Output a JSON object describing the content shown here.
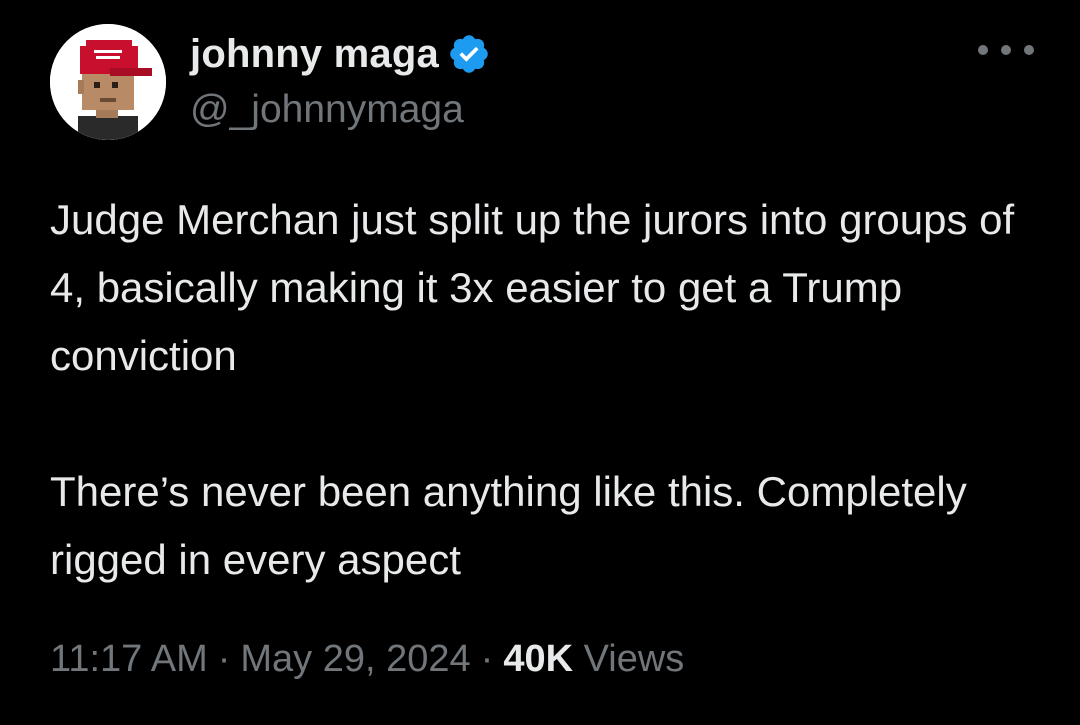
{
  "author": {
    "display_name": "johnny maga",
    "handle": "@_johnnymaga",
    "verified_color": "#1d9bf0",
    "avatar_icon": "pixel-art-avatar-red-cap",
    "cap_color": "#c8102e"
  },
  "tweet": {
    "paragraphs": [
      "Judge Merchan just split up the jurors into groups of 4, basically making it 3x easier to get a Trump conviction",
      "There’s never been anything like this. Completely rigged in every aspect"
    ]
  },
  "meta": {
    "time": "11:17 AM",
    "separator": "·",
    "date": "May 29, 2024",
    "views_count": "40K",
    "views_label": "Views"
  },
  "colors": {
    "background": "#000000",
    "primary_text": "#e7e9ea",
    "secondary_text": "#71767b"
  }
}
